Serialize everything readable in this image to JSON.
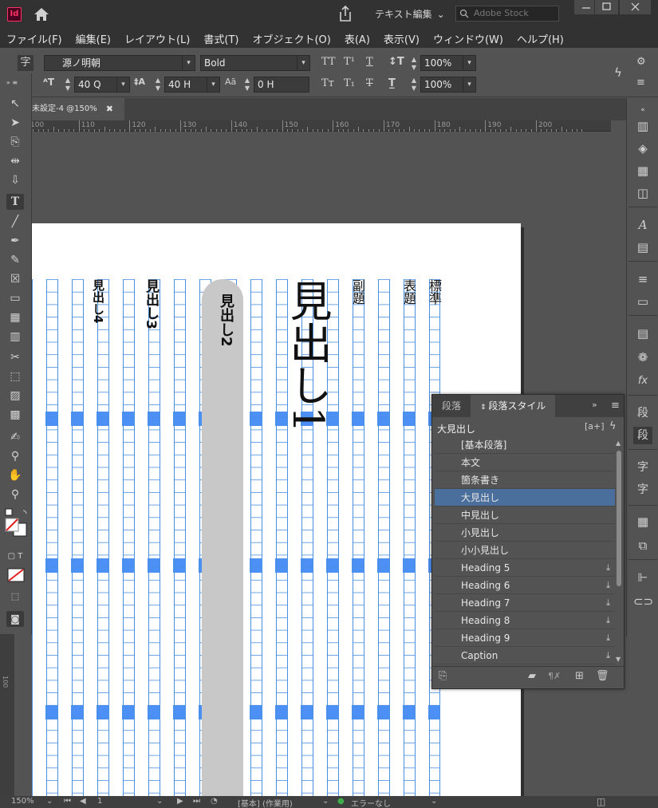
{
  "app": {
    "logo_text": "Id",
    "workspace": "テキスト編集",
    "stock_placeholder": "Adobe Stock"
  },
  "menu": [
    "ファイル(F)",
    "編集(E)",
    "レイアウト(L)",
    "書式(T)",
    "オブジェクト(O)",
    "表(A)",
    "表示(V)",
    "ウィンドウ(W)",
    "ヘルプ(H)"
  ],
  "control": {
    "mode_glyph": "字",
    "font_family": "源ノ明朝",
    "font_style": "Bold",
    "font_size": "40 Q",
    "leading": "40 H",
    "tracking": "0 H",
    "vscale": "100%",
    "hscale": "100%"
  },
  "document": {
    "tab_title": "未設定-4 @150%",
    "ruler_labels": [
      "100",
      "110",
      "120",
      "130",
      "140",
      "150",
      "160",
      "170",
      "180",
      "190",
      "200"
    ],
    "vruler_label": "100"
  },
  "canvas": {
    "heading1": "見出し1",
    "heading2": "見出し2",
    "heading3": "見出し3",
    "heading4": "見出し4",
    "subtitle": "副題",
    "title": "表題",
    "standard": "標準"
  },
  "panel": {
    "tab_paragraph": "段落",
    "tab_para_styles": "段落スタイル",
    "current_style": "大見出し",
    "styles": [
      {
        "label": "[基本段落]",
        "selected": false,
        "imported": false
      },
      {
        "label": "本文",
        "selected": false,
        "imported": false
      },
      {
        "label": "箇条書き",
        "selected": false,
        "imported": false
      },
      {
        "label": "大見出し",
        "selected": true,
        "imported": false
      },
      {
        "label": "中見出し",
        "selected": false,
        "imported": false
      },
      {
        "label": "小見出し",
        "selected": false,
        "imported": false
      },
      {
        "label": "小小見出し",
        "selected": false,
        "imported": false
      },
      {
        "label": "Heading 5",
        "selected": false,
        "imported": true
      },
      {
        "label": "Heading 6",
        "selected": false,
        "imported": true
      },
      {
        "label": "Heading 7",
        "selected": false,
        "imported": true
      },
      {
        "label": "Heading 8",
        "selected": false,
        "imported": true
      },
      {
        "label": "Heading 9",
        "selected": false,
        "imported": true
      },
      {
        "label": "Caption",
        "selected": false,
        "imported": true
      }
    ]
  },
  "right_dock": {
    "paragraph_glyph": "段",
    "para_style_glyph": "段",
    "char_glyph": "字",
    "char_style_glyph": "字",
    "fx_label": "fx"
  },
  "status": {
    "zoom": "150%",
    "page": "1",
    "master": "[基本] (作業用)",
    "preflight": "エラーなし"
  },
  "colors": {
    "accent_selected": "#4b6f9c",
    "grid_line": "#4a90e2",
    "grid_highlight": "#4c8ff5",
    "preflight_ok": "#3fae49"
  }
}
